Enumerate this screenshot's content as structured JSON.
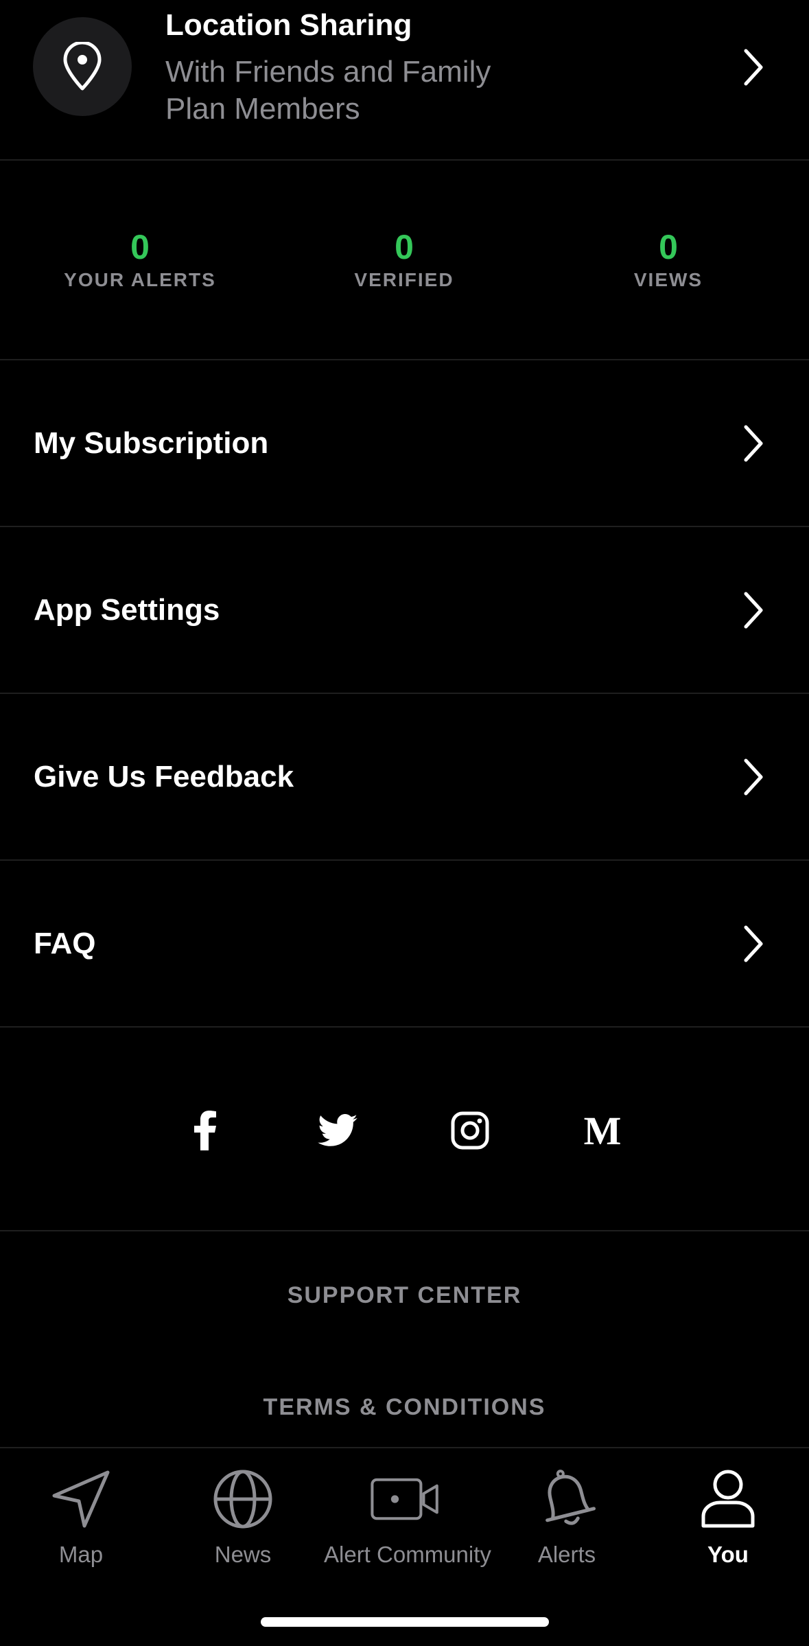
{
  "location_sharing": {
    "title": "Location Sharing",
    "subtitle_line1": "With Friends and Family",
    "subtitle_line2": "Plan Members",
    "icon": "location-pin-icon"
  },
  "stats": [
    {
      "value": "0",
      "label": "YOUR ALERTS"
    },
    {
      "value": "0",
      "label": "VERIFIED"
    },
    {
      "value": "0",
      "label": "VIEWS"
    }
  ],
  "menu": [
    {
      "label": "My Subscription"
    },
    {
      "label": "App Settings"
    },
    {
      "label": "Give Us Feedback"
    },
    {
      "label": "FAQ"
    }
  ],
  "social": [
    "facebook-icon",
    "twitter-icon",
    "instagram-icon",
    "medium-icon"
  ],
  "footer": {
    "support": "SUPPORT CENTER",
    "terms": "TERMS & CONDITIONS"
  },
  "tabs": [
    {
      "label": "Map",
      "icon": "navigation-arrow-icon",
      "active": false
    },
    {
      "label": "News",
      "icon": "globe-icon",
      "active": false
    },
    {
      "label": "Alert Community",
      "icon": "video-camera-icon",
      "active": false
    },
    {
      "label": "Alerts",
      "icon": "bell-icon",
      "active": false
    },
    {
      "label": "You",
      "icon": "person-icon",
      "active": true
    }
  ],
  "colors": {
    "background": "#000000",
    "accent_green": "#34c759",
    "muted_gray": "#8e8e93",
    "divider": "#1f1f1f"
  }
}
